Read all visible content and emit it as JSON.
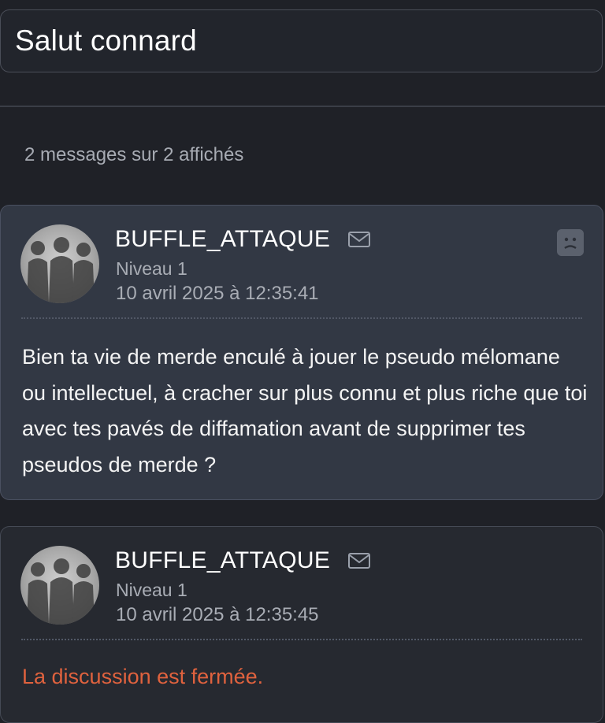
{
  "topic": {
    "title": "Salut connard"
  },
  "message_count": "2 messages sur 2 affichés",
  "messages": [
    {
      "author": "BUFFLE_ATTAQUE",
      "level": "Niveau 1",
      "date": "10 avril 2025 à 12:35:41",
      "body": "Bien ta vie de merde enculé à jouer le pseudo mélomane ou intellectuel, à cracher sur plus connu et plus riche que toi avec tes pavés de diffamation avant de supprimer tes pseudos de merde ?"
    },
    {
      "author": "BUFFLE_ATTAQUE",
      "level": "Niveau 1",
      "date": "10 avril 2025 à 12:35:45",
      "closed_notice": "La discussion est fermée."
    }
  ],
  "icons": {
    "mail": "envelope-icon",
    "report": "sad-face-report-icon",
    "avatar": "group-silhouette-avatar"
  },
  "colors": {
    "background": "#1f2127",
    "card": "#323844",
    "closed_notice": "#e0623e",
    "muted_text": "#a9adb5"
  }
}
